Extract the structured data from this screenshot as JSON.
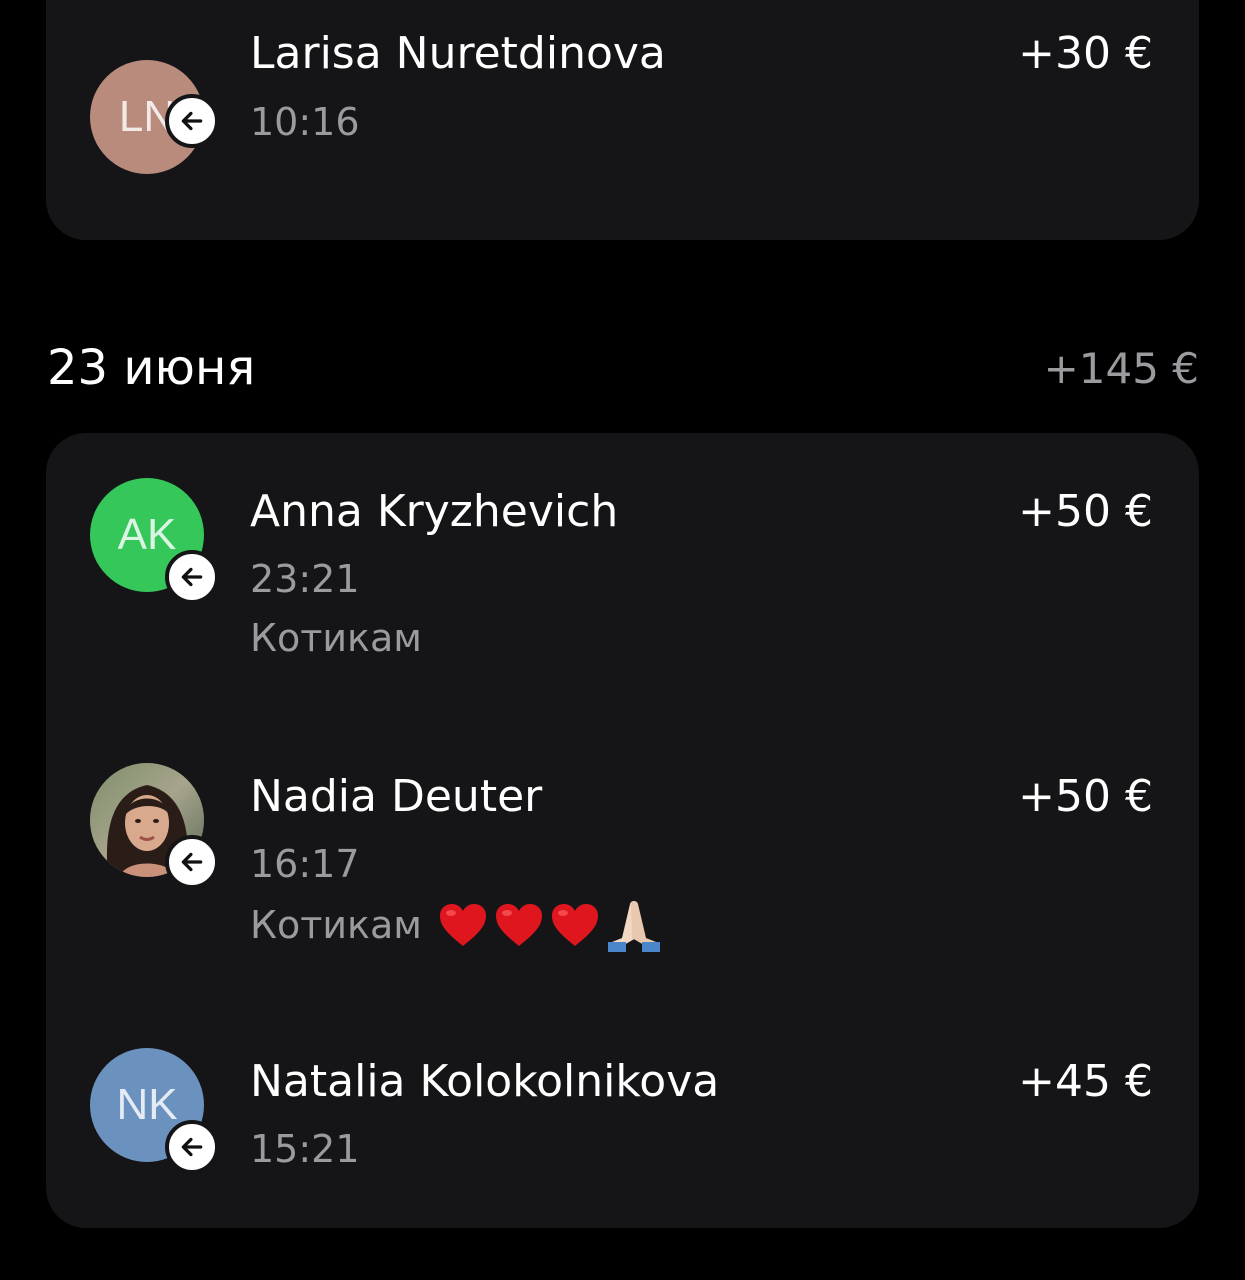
{
  "colors": {
    "background": "#000000",
    "card": "#151517",
    "text_primary": "#ffffff",
    "text_secondary": "#9a9a9f",
    "badge": "#ffffff"
  },
  "top_card": {
    "transactions": [
      {
        "initials": "LN",
        "avatar_color": "#b88b7c",
        "name": "Larisa Nuretdinova",
        "amount": "+30 €",
        "time": "10:16",
        "direction_icon": "arrow-left-icon"
      }
    ]
  },
  "section": {
    "date": "23 июня",
    "total": "+145 €",
    "transactions": [
      {
        "initials": "AK",
        "avatar_color": "#35c759",
        "name": "Anna Kryzhevich",
        "amount": "+50 €",
        "time": "23:21",
        "comment": "Котикам",
        "direction_icon": "arrow-left-icon"
      },
      {
        "initials": "",
        "avatar_photo": true,
        "name": "Nadia Deuter",
        "amount": "+50 €",
        "time": "16:17",
        "comment": "Котикам",
        "emojis": [
          "heart-icon",
          "heart-icon",
          "heart-icon",
          "praying-hands-icon"
        ],
        "direction_icon": "arrow-left-icon"
      },
      {
        "initials": "NK",
        "avatar_color": "#6b92bf",
        "name": "Natalia Kolokolnikova",
        "amount": "+45 €",
        "time": "15:21",
        "direction_icon": "arrow-left-icon"
      }
    ]
  }
}
